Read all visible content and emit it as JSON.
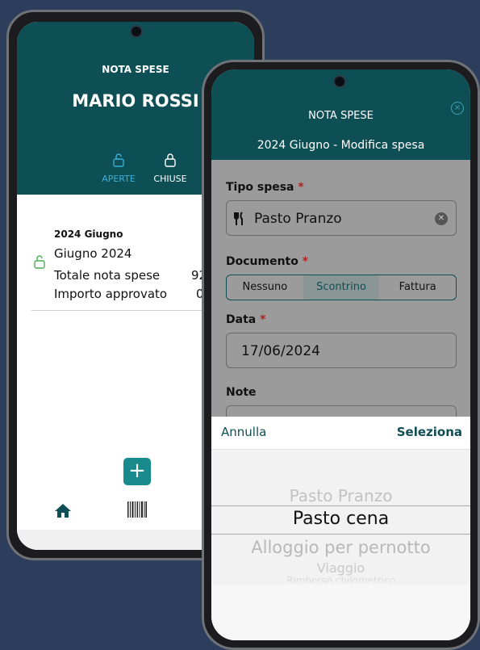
{
  "phone1": {
    "header_title": "NOTA SPESE",
    "user_name": "MARIO ROSSI",
    "tabs": [
      {
        "label": "APERTE",
        "icon": "unlock-icon",
        "color": "#38b0d8"
      },
      {
        "label": "CHIUSE",
        "icon": "lock-icon",
        "color": "#ffffff"
      }
    ],
    "report": {
      "title": "2024 Giugno",
      "subtitle": "Giugno 2024",
      "total_label": "Totale nota spese",
      "total_value": "92",
      "approved_label": "Importo approvato",
      "approved_value": "0"
    },
    "nav": [
      "home-icon",
      "barcode-icon"
    ]
  },
  "phone2": {
    "header_title": "NOTA SPESE",
    "header_subtitle": "2024 Giugno - Modifica spesa",
    "form": {
      "tipo_label": "Tipo spesa",
      "tipo_value": "Pasto Pranzo",
      "documento_label": "Documento",
      "documento_options": [
        "Nessuno",
        "Scontrino",
        "Fattura"
      ],
      "documento_selected": "Scontrino",
      "data_label": "Data",
      "data_value": "17/06/2024",
      "note_label": "Note",
      "required_mark": "*"
    },
    "picker": {
      "cancel": "Annulla",
      "confirm": "Seleziona",
      "options": [
        "Pasto Pranzo",
        "Pasto cena",
        "Alloggio per pernotto",
        "Viaggio",
        "Rimborso chilometrico"
      ],
      "selected": "Pasto cena"
    }
  },
  "colors": {
    "brand": "#0e4f55",
    "accent": "#1a8b8c",
    "required": "#b52020"
  }
}
